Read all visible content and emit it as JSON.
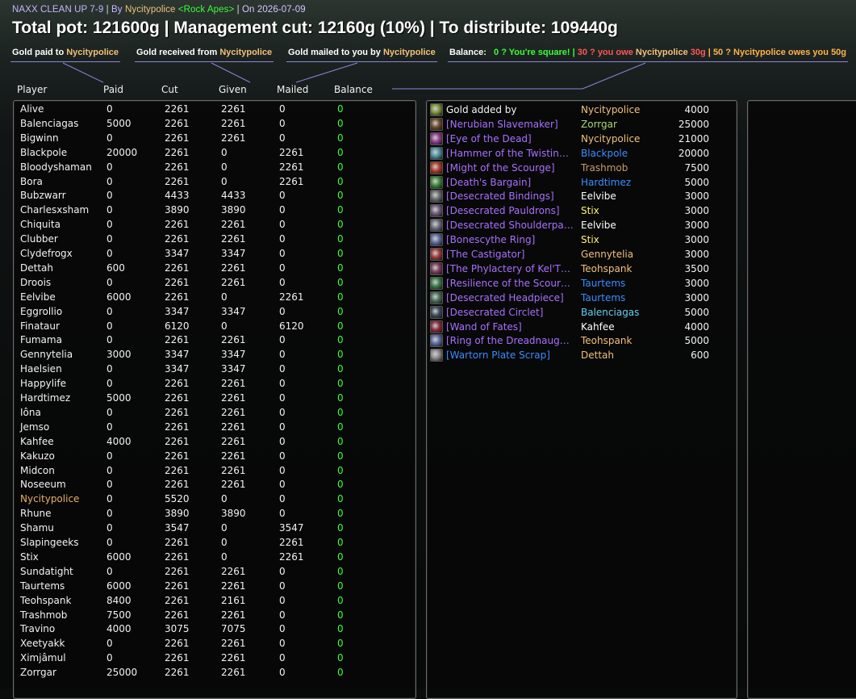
{
  "header": {
    "raid_name": "NAXX CLEAN UP 7-9",
    "by_label": "By",
    "leader": "Nycitypolice",
    "guild": "<Rock Apes>",
    "on_label": "On",
    "date": "2026-07-09",
    "summary": "Total pot: 121600g | Management cut: 12160g (10%) | To distribute: 109440g"
  },
  "legend": {
    "paid_label": "Gold paid to",
    "received_label": "Gold received from",
    "mailed_label": "Gold mailed to you by",
    "name": "Nycitypolice",
    "balance_label": "Balance:",
    "square_text": "0 ? You're square!",
    "owe_prefix": "30 ? you owe",
    "owe_suffix": "30g",
    "owes_prefix": "50 ? Nycitypolice owes you",
    "owes_amount": "50g",
    "divider": "|"
  },
  "columns": {
    "player": "Player",
    "paid": "Paid",
    "cut": "Cut",
    "given": "Given",
    "mailed": "Mailed",
    "balance": "Balance"
  },
  "players": [
    {
      "name": "Alive",
      "paid": "0",
      "cut": "2261",
      "given": "2261",
      "mailed": "0",
      "balance": "0"
    },
    {
      "name": "Balenciagas",
      "paid": "5000",
      "cut": "2261",
      "given": "2261",
      "mailed": "0",
      "balance": "0"
    },
    {
      "name": "Bigwinn",
      "paid": "0",
      "cut": "2261",
      "given": "2261",
      "mailed": "0",
      "balance": "0"
    },
    {
      "name": "Blackpole",
      "paid": "20000",
      "cut": "2261",
      "given": "0",
      "mailed": "2261",
      "balance": "0"
    },
    {
      "name": "Bloodyshaman",
      "paid": "0",
      "cut": "2261",
      "given": "0",
      "mailed": "2261",
      "balance": "0"
    },
    {
      "name": "Bora",
      "paid": "0",
      "cut": "2261",
      "given": "0",
      "mailed": "2261",
      "balance": "0"
    },
    {
      "name": "Bubzwarr",
      "paid": "0",
      "cut": "4433",
      "given": "4433",
      "mailed": "0",
      "balance": "0"
    },
    {
      "name": "Charlesxsham",
      "paid": "0",
      "cut": "3890",
      "given": "3890",
      "mailed": "0",
      "balance": "0"
    },
    {
      "name": "Chiquita",
      "paid": "0",
      "cut": "2261",
      "given": "2261",
      "mailed": "0",
      "balance": "0"
    },
    {
      "name": "Clubber",
      "paid": "0",
      "cut": "2261",
      "given": "2261",
      "mailed": "0",
      "balance": "0"
    },
    {
      "name": "Clydefrogx",
      "paid": "0",
      "cut": "3347",
      "given": "3347",
      "mailed": "0",
      "balance": "0"
    },
    {
      "name": "Dettah",
      "paid": "600",
      "cut": "2261",
      "given": "2261",
      "mailed": "0",
      "balance": "0"
    },
    {
      "name": "Droois",
      "paid": "0",
      "cut": "2261",
      "given": "2261",
      "mailed": "0",
      "balance": "0"
    },
    {
      "name": "Eelvibe",
      "paid": "6000",
      "cut": "2261",
      "given": "0",
      "mailed": "2261",
      "balance": "0"
    },
    {
      "name": "Eggrollio",
      "paid": "0",
      "cut": "3347",
      "given": "3347",
      "mailed": "0",
      "balance": "0"
    },
    {
      "name": "Finataur",
      "paid": "0",
      "cut": "6120",
      "given": "0",
      "mailed": "6120",
      "balance": "0"
    },
    {
      "name": "Fumama",
      "paid": "0",
      "cut": "2261",
      "given": "2261",
      "mailed": "0",
      "balance": "0"
    },
    {
      "name": "Gennytelia",
      "paid": "3000",
      "cut": "3347",
      "given": "3347",
      "mailed": "0",
      "balance": "0"
    },
    {
      "name": "Haelsien",
      "paid": "0",
      "cut": "3347",
      "given": "3347",
      "mailed": "0",
      "balance": "0"
    },
    {
      "name": "Happylife",
      "paid": "0",
      "cut": "2261",
      "given": "2261",
      "mailed": "0",
      "balance": "0"
    },
    {
      "name": "Hardtimez",
      "paid": "5000",
      "cut": "2261",
      "given": "2261",
      "mailed": "0",
      "balance": "0"
    },
    {
      "name": "Iôna",
      "paid": "0",
      "cut": "2261",
      "given": "2261",
      "mailed": "0",
      "balance": "0"
    },
    {
      "name": "Jemso",
      "paid": "0",
      "cut": "2261",
      "given": "2261",
      "mailed": "0",
      "balance": "0"
    },
    {
      "name": "Kahfee",
      "paid": "4000",
      "cut": "2261",
      "given": "2261",
      "mailed": "0",
      "balance": "0"
    },
    {
      "name": "Kakuzo",
      "paid": "0",
      "cut": "2261",
      "given": "2261",
      "mailed": "0",
      "balance": "0"
    },
    {
      "name": "Midcon",
      "paid": "0",
      "cut": "2261",
      "given": "2261",
      "mailed": "0",
      "balance": "0"
    },
    {
      "name": "Noseeum",
      "paid": "0",
      "cut": "2261",
      "given": "2261",
      "mailed": "0",
      "balance": "0"
    },
    {
      "name": "Nycitypolice",
      "paid": "0",
      "cut": "5520",
      "given": "0",
      "mailed": "0",
      "balance": "0",
      "highlight": true
    },
    {
      "name": "Rhune",
      "paid": "0",
      "cut": "3890",
      "given": "3890",
      "mailed": "0",
      "balance": "0"
    },
    {
      "name": "Shamu",
      "paid": "0",
      "cut": "3547",
      "given": "0",
      "mailed": "3547",
      "balance": "0"
    },
    {
      "name": "Slapingeeks",
      "paid": "0",
      "cut": "2261",
      "given": "0",
      "mailed": "2261",
      "balance": "0"
    },
    {
      "name": "Stix",
      "paid": "6000",
      "cut": "2261",
      "given": "0",
      "mailed": "2261",
      "balance": "0"
    },
    {
      "name": "Sundatight",
      "paid": "0",
      "cut": "2261",
      "given": "2261",
      "mailed": "0",
      "balance": "0"
    },
    {
      "name": "Taurtems",
      "paid": "6000",
      "cut": "2261",
      "given": "2261",
      "mailed": "0",
      "balance": "0"
    },
    {
      "name": "Teohspank",
      "paid": "8400",
      "cut": "2261",
      "given": "2161",
      "mailed": "0",
      "balance": "0"
    },
    {
      "name": "Trashmob",
      "paid": "7500",
      "cut": "2261",
      "given": "2261",
      "mailed": "0",
      "balance": "0"
    },
    {
      "name": "Travino",
      "paid": "4000",
      "cut": "3075",
      "given": "7075",
      "mailed": "0",
      "balance": "0"
    },
    {
      "name": "Xeetyakk",
      "paid": "0",
      "cut": "2261",
      "given": "2261",
      "mailed": "0",
      "balance": "0"
    },
    {
      "name": "Ximjâmul",
      "paid": "0",
      "cut": "2261",
      "given": "2261",
      "mailed": "0",
      "balance": "0"
    },
    {
      "name": "Zorrgar",
      "paid": "25000",
      "cut": "2261",
      "given": "2261",
      "mailed": "0",
      "balance": "0"
    }
  ],
  "items": [
    {
      "item": "Gold added by",
      "buyer": "Nycitypolice",
      "amount": "4000",
      "quality": "white",
      "buyer_class": "default",
      "icon": "coin-icon",
      "icon_color": "#7a8f3a"
    },
    {
      "item": "[Nerubian Slavemaker]",
      "buyer": "Zorrgar",
      "amount": "25000",
      "quality": "epic",
      "buyer_class": "hunter",
      "icon": "crossbow-icon",
      "icon_color": "#6b4a2a"
    },
    {
      "item": "[Eye of the Dead]",
      "buyer": "Nycitypolice",
      "amount": "21000",
      "quality": "epic",
      "buyer_class": "default",
      "icon": "eye-trinket-icon",
      "icon_color": "#8e3a8e"
    },
    {
      "item": "[Hammer of the Twistin…",
      "buyer": "Blackpole",
      "amount": "20000",
      "quality": "epic",
      "buyer_class": "shaman",
      "icon": "hammer-icon",
      "icon_color": "#4a8fa0"
    },
    {
      "item": "[Might of the Scourge]",
      "buyer": "Trashmob",
      "amount": "7500",
      "quality": "epic",
      "buyer_class": "warrior",
      "icon": "shoulder-enchant-icon",
      "icon_color": "#b03a2a"
    },
    {
      "item": "[Death's Bargain]",
      "buyer": "Hardtimez",
      "amount": "5000",
      "quality": "epic",
      "buyer_class": "shaman",
      "icon": "shoulder-enchant-icon",
      "icon_color": "#3a8a3a"
    },
    {
      "item": "[Desecrated Bindings]",
      "buyer": "Eelvibe",
      "amount": "3000",
      "quality": "epic",
      "buyer_class": "priest",
      "icon": "bracer-icon",
      "icon_color": "#6b6b6b"
    },
    {
      "item": "[Desecrated Pauldrons]",
      "buyer": "Stix",
      "amount": "3000",
      "quality": "epic",
      "buyer_class": "rogue",
      "icon": "pauldron-icon",
      "icon_color": "#6b5a7a"
    },
    {
      "item": "[Desecrated Shoulderpa…",
      "buyer": "Eelvibe",
      "amount": "3000",
      "quality": "epic",
      "buyer_class": "priest",
      "icon": "pauldron-icon",
      "icon_color": "#6b6b7a"
    },
    {
      "item": "[Bonescythe Ring]",
      "buyer": "Stix",
      "amount": "3000",
      "quality": "epic",
      "buyer_class": "rogue",
      "icon": "ring-icon",
      "icon_color": "#5a6a9a"
    },
    {
      "item": "[The Castigator]",
      "buyer": "Gennytelia",
      "amount": "3000",
      "quality": "epic",
      "buyer_class": "default",
      "icon": "sword-icon",
      "icon_color": "#9a3a3a"
    },
    {
      "item": "[The Phylactery of Kel'T…",
      "buyer": "Teohspank",
      "amount": "3500",
      "quality": "epic",
      "buyer_class": "default",
      "icon": "phylactery-icon",
      "icon_color": "#7a3a5a"
    },
    {
      "item": "[Resilience of the Scour…",
      "buyer": "Taurtems",
      "amount": "3000",
      "quality": "epic",
      "buyer_class": "shaman",
      "icon": "shoulder-enchant-icon",
      "icon_color": "#3a7a4a"
    },
    {
      "item": "[Desecrated Headpiece]",
      "buyer": "Taurtems",
      "amount": "3000",
      "quality": "epic",
      "buyer_class": "shaman",
      "icon": "helm-icon",
      "icon_color": "#4a6a5a"
    },
    {
      "item": "[Desecrated Circlet]",
      "buyer": "Balenciagas",
      "amount": "5000",
      "quality": "epic",
      "buyer_class": "mage",
      "icon": "circlet-icon",
      "icon_color": "#3a4a5a"
    },
    {
      "item": "[Wand of Fates]",
      "buyer": "Kahfee",
      "amount": "4000",
      "quality": "epic",
      "buyer_class": "priest",
      "icon": "wand-icon",
      "icon_color": "#8a2a3a"
    },
    {
      "item": "[Ring of the Dreadnaug…",
      "buyer": "Teohspank",
      "amount": "5000",
      "quality": "epic",
      "buyer_class": "default",
      "icon": "ring-icon",
      "icon_color": "#5a6aa0"
    },
    {
      "item": "[Wartorn Plate Scrap]",
      "buyer": "Dettah",
      "amount": "600",
      "quality": "rare",
      "buyer_class": "default",
      "icon": "plate-scrap-icon",
      "icon_color": "#8a8a8a"
    }
  ]
}
